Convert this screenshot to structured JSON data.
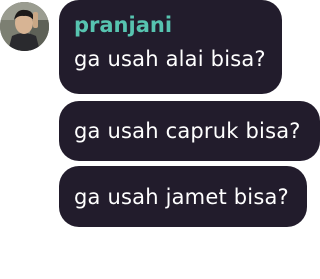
{
  "chat": {
    "author": {
      "name": "pranjani"
    },
    "messages": [
      {
        "text": "ga usah alai bisa?"
      },
      {
        "text": "ga usah capruk bisa?"
      },
      {
        "text": "ga usah jamet bisa?"
      }
    ]
  },
  "colors": {
    "bubble": "#221c2c",
    "author_name": "#57c4b0",
    "message_text": "#ffffff",
    "background": "#ffffff"
  }
}
